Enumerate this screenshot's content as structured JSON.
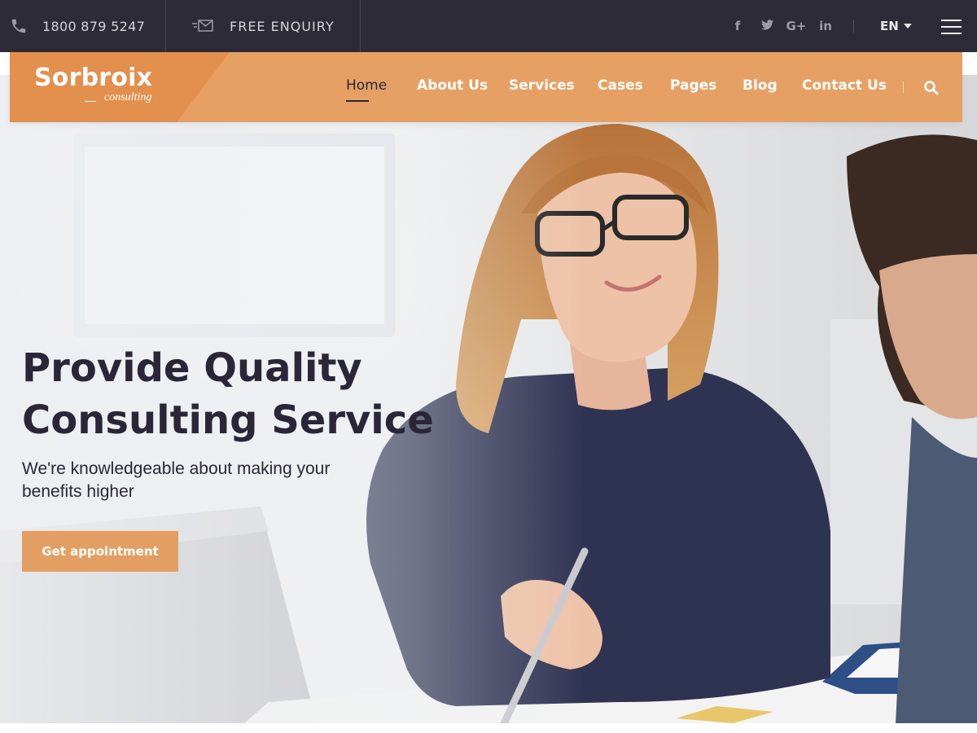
{
  "topbar": {
    "phone": "1800 879 5247",
    "enquiry": "FREE ENQUIRY",
    "socials": [
      {
        "icon": "facebook-icon",
        "glyph": "f"
      },
      {
        "icon": "twitter-icon",
        "glyph": "🐦"
      },
      {
        "icon": "google-plus-icon",
        "glyph": "G+"
      },
      {
        "icon": "linkedin-icon",
        "glyph": "in"
      }
    ],
    "language": "EN"
  },
  "brand": {
    "name": "Sorbroix",
    "tagline": "consulting"
  },
  "nav": {
    "items": [
      {
        "label": "Home",
        "active": true
      },
      {
        "label": "About Us",
        "active": false
      },
      {
        "label": "Services",
        "active": false
      },
      {
        "label": "Cases",
        "active": false
      },
      {
        "label": "Pages",
        "active": false
      },
      {
        "label": "Blog",
        "active": false
      },
      {
        "label": "Contact Us",
        "active": false
      }
    ]
  },
  "hero": {
    "title_line1": "Provide Quality",
    "title_line2": "Consulting Service",
    "subtitle": "We're knowledgeable about making your benefits higher",
    "cta_label": "Get appointment"
  },
  "colors": {
    "accent": "#e6a064",
    "accent_dark": "#e38f4e",
    "topbar_bg": "#2d2b37",
    "heading": "#2a2637"
  }
}
